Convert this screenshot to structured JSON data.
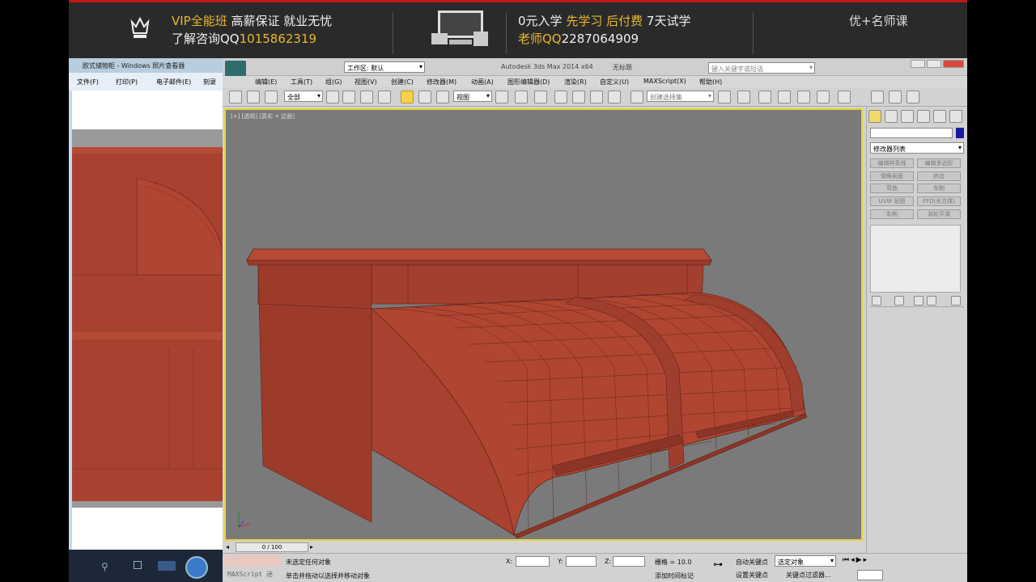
{
  "banner": {
    "vip_title": "VIP全能班",
    "vip_slogan": "高薪保证  就业无忧",
    "consult": "了解咨询QQ",
    "consult_qq": "1015862319",
    "offer_line_a": "0元入学",
    "offer_line_b": "先学习",
    "offer_line_c": "后付费",
    "offer_line_d": "7天试学",
    "teacher": "老师QQ",
    "teacher_qq": "2287064909",
    "brand": "优+名师课"
  },
  "viewer": {
    "title": "欧式储物柜 - Windows 照片查看器",
    "menu": [
      "文件(F)",
      "打印(P)",
      "电子邮件(E)",
      "刻录"
    ]
  },
  "max": {
    "title": "Autodesk 3ds Max  2014 x64",
    "doc": "无标题",
    "workspace": "工作区: 默认",
    "search_placeholder": "键入关键字或短语",
    "menu": [
      "编辑(E)",
      "工具(T)",
      "组(G)",
      "视图(V)",
      "创建(C)",
      "修改器(M)",
      "动画(A)",
      "图形编辑器(D)",
      "渲染(R)",
      "自定义(U)",
      "MAXScript(X)",
      "帮助(H)"
    ],
    "filter": "全部",
    "coord": "视图",
    "selection_set": "创建选择集",
    "viewport_label": "[+] [透视] [真实 + 边面]",
    "modifier_list": "修改器列表",
    "modifier_buttons": [
      "编辑样条线",
      "编辑多边形",
      "倒角剖面",
      "挤出",
      "弯曲",
      "车削",
      "UVW 贴图",
      "FFD(长方体)",
      "车削",
      "涡轮平滑"
    ],
    "timeline": "0 / 100",
    "status_none": "未选定任何对象",
    "status_hint": "单击并拖动以选择并移动对象",
    "maxscript": "MAXScript 迷",
    "x_label": "X:",
    "y_label": "Y:",
    "z_label": "Z:",
    "grid": "栅格 = 10.0",
    "add_time_tag": "添加时间标记",
    "auto_key": "自动关键点",
    "set_key": "设置关键点",
    "selected_obj": "选定对象",
    "key_filter": "关键点过滤器..."
  },
  "colors": {
    "model": "#a8412f",
    "viewport_bg": "#7a7a7a",
    "banner_bg": "#2a2a2a",
    "gold": "#e8b830"
  }
}
